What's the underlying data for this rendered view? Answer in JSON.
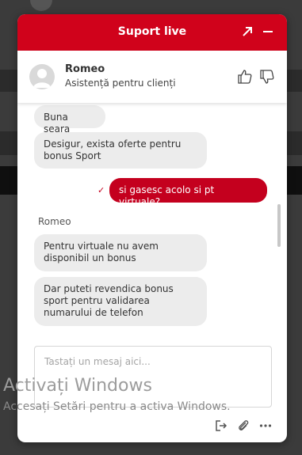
{
  "chat": {
    "title": "Suport live",
    "agent": {
      "name": "Romeo",
      "role": "Asistență pentru clienți"
    },
    "messages": [
      {
        "from": "agent",
        "text": "Buna seara"
      },
      {
        "from": "agent",
        "text": "Desigur, exista oferte pentru bonus Sport"
      },
      {
        "from": "user",
        "text": "si gasesc acolo si pt virtuale?"
      },
      {
        "from": "agent",
        "sender": "Romeo",
        "text": "Pentru virtuale nu avem disponibil un bonus"
      },
      {
        "from": "agent",
        "text": "Dar puteti revendica bonus sport pentru validarea numarului de telefon"
      }
    ],
    "input_placeholder": "Tastați un mesaj aici...",
    "delivered_glyph": "✓"
  },
  "watermark": {
    "title": "Activați Windows",
    "subtitle": "Accesați Setări pentru a activa Windows."
  },
  "colors": {
    "brand": "#d0021b",
    "bubble": "#ececec",
    "user_bubble": "#c4001e"
  }
}
